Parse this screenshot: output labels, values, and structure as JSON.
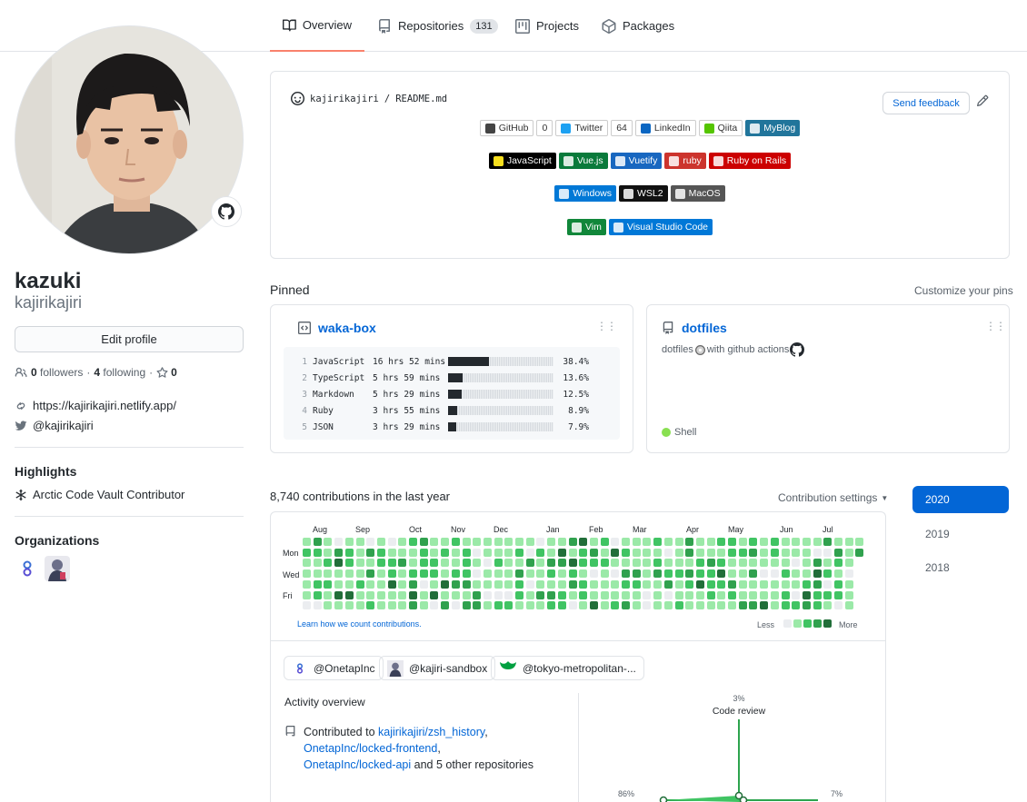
{
  "tabs": [
    {
      "label": "Overview",
      "icon": "book-icon"
    },
    {
      "label": "Repositories",
      "icon": "repo-icon",
      "count": "131"
    },
    {
      "label": "Projects",
      "icon": "project-icon"
    },
    {
      "label": "Packages",
      "icon": "package-icon"
    }
  ],
  "profile": {
    "name": "kazuki",
    "login": "kajirikajiri",
    "edit_label": "Edit profile",
    "followers_count": "0",
    "followers_label": "followers",
    "following_count": "4",
    "following_label": "following",
    "stars_count": "0",
    "website": "https://kajirikajiri.netlify.app/",
    "twitter": "@kajirikajiri",
    "highlights_title": "Highlights",
    "highlight_item": "Arctic Code Vault Contributor",
    "orgs_title": "Organizations"
  },
  "readme": {
    "owner": "kajirikajiri",
    "sep": "/",
    "file": "README.md",
    "feedback_label": "Send feedback",
    "badge_rows": [
      [
        {
          "label": "GitHub",
          "bg": "#ffffff",
          "fg": "#333333",
          "icon": "github-icon"
        },
        {
          "label": "0",
          "bg": "#ffffff",
          "fg": "#333333"
        },
        {
          "label": "Twitter",
          "bg": "#ffffff",
          "fg": "#333333",
          "icon": "twitter-icon"
        },
        {
          "label": "64",
          "bg": "#ffffff",
          "fg": "#333333"
        },
        {
          "label": "LinkedIn",
          "bg": "#ffffff",
          "fg": "#333333",
          "icon": "linkedin-icon"
        },
        {
          "label": "Qiita",
          "bg": "#ffffff",
          "fg": "#333333",
          "icon": "qiita-icon"
        },
        {
          "label": "MyBlog",
          "bg": "#21759b",
          "fg": "#ffffff",
          "icon": "wordpress-icon"
        }
      ],
      [
        {
          "label": "JavaScript",
          "bg": "#000000",
          "fg": "#ffffff",
          "icon": "javascript-icon"
        },
        {
          "label": "Vue.js",
          "bg": "#0a7a3b",
          "fg": "#ffffff",
          "icon": "vue-icon"
        },
        {
          "label": "Vuetify",
          "bg": "#1867c0",
          "fg": "#ffffff",
          "icon": "vuetify-icon"
        },
        {
          "label": "ruby",
          "bg": "#cc342d",
          "fg": "#ffffff",
          "icon": "ruby-icon"
        },
        {
          "label": "Ruby on Rails",
          "bg": "#cc0000",
          "fg": "#ffffff",
          "icon": "rails-icon"
        }
      ],
      [
        {
          "label": "Windows",
          "bg": "#0078d6",
          "fg": "#ffffff",
          "icon": "windows-icon"
        },
        {
          "label": "WSL2",
          "bg": "#111111",
          "fg": "#ffffff",
          "icon": "linux-icon"
        },
        {
          "label": "MacOS",
          "bg": "#555555",
          "fg": "#ffffff",
          "icon": "apple-icon"
        }
      ],
      [
        {
          "label": "Vim",
          "bg": "#11873a",
          "fg": "#ffffff",
          "icon": "vim-icon"
        },
        {
          "label": "Visual Studio Code",
          "bg": "#0078d7",
          "fg": "#ffffff",
          "icon": "vscode-icon"
        }
      ]
    ]
  },
  "pinned": {
    "title": "Pinned",
    "customize": "Customize your pins",
    "waka": {
      "name": "waka-box",
      "rows": [
        {
          "n": "1",
          "lang": "JavaScript",
          "time": "16 hrs 52 mins",
          "pct_text": "38.4%",
          "pct": 0.384
        },
        {
          "n": "2",
          "lang": "TypeScript",
          "time": "5 hrs 59 mins",
          "pct_text": "13.6%",
          "pct": 0.136
        },
        {
          "n": "3",
          "lang": "Markdown",
          "time": "5 hrs 29 mins",
          "pct_text": "12.5%",
          "pct": 0.125
        },
        {
          "n": "4",
          "lang": "Ruby",
          "time": "3 hrs 55 mins",
          "pct_text": "8.9%",
          "pct": 0.089
        },
        {
          "n": "5",
          "lang": "JSON",
          "time": "3 hrs 29 mins",
          "pct_text": "7.9%",
          "pct": 0.079
        }
      ]
    },
    "dotfiles": {
      "name": "dotfiles",
      "description": "dotfiles",
      "description_tail": "with github actions",
      "language": "Shell",
      "lang_color": "#89e051"
    }
  },
  "contrib": {
    "heading": "8,740 contributions in the last year",
    "settings": "Contribution settings",
    "months": [
      "Aug",
      "Sep",
      "Oct",
      "Nov",
      "Dec",
      "Jan",
      "Feb",
      "Mar",
      "Apr",
      "May",
      "Jun",
      "Jul"
    ],
    "days": [
      "Mon",
      "Wed",
      "Fri"
    ],
    "learn": "Learn how we count contributions.",
    "less": "Less",
    "more": "More",
    "colors": [
      "#ebedf0",
      "#9be9a8",
      "#40c463",
      "#30a14e",
      "#216e39"
    ],
    "years": [
      "2020",
      "2019",
      "2018"
    ]
  },
  "activity": {
    "orgs": [
      "@OnetapInc",
      "@kajiri-sandbox",
      "@tokyo-metropolitan-..."
    ],
    "title": "Activity overview",
    "contributed_to": "Contributed to",
    "repo1": "kajirikajiri/zsh_history",
    "repo2": "OnetapInc/locked-frontend",
    "repo3": "OnetapInc/locked-api",
    "others": "and 5 other repositories",
    "chart": {
      "code_review_pct": "3%",
      "code_review_label": "Code review",
      "left_pct": "86%",
      "right_pct": "7%"
    }
  }
}
